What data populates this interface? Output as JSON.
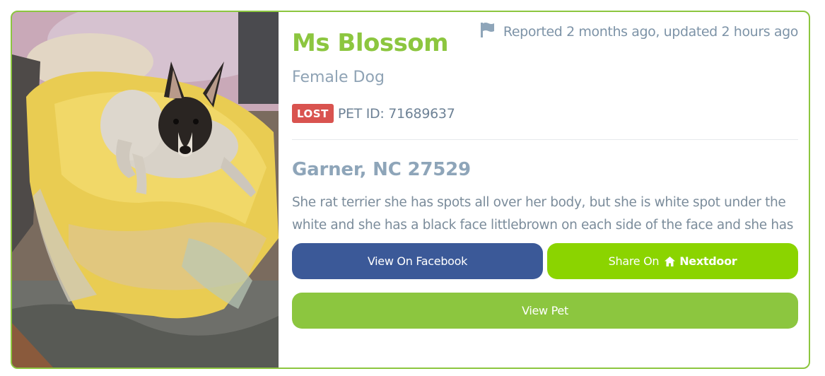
{
  "pet": {
    "name": "Ms Blossom",
    "subtitle": "Female Dog",
    "status_badge": "LOST",
    "pet_id": "PET ID: 71689637",
    "location": "Garner, NC 27529",
    "description": "She rat terrier she has spots all over her body, but she is white spot under the white and she has a black face littlebrown on each side of the face and she has a...",
    "reported": "Reported 2 months ago, updated 2 hours ago",
    "photo_icon": "dog-photo"
  },
  "actions": {
    "facebook_label": "View On Facebook",
    "nextdoor_prefix": "Share On",
    "nextdoor_brand": "Nextdoor",
    "view_pet_label": "View Pet"
  },
  "icons": {
    "flag": "flag-icon",
    "house": "house-icon"
  },
  "colors": {
    "brand_green": "#8cc63f",
    "lost_red": "#d9534f",
    "facebook_blue": "#3b5998",
    "nextdoor_green": "#8bd400",
    "muted_text": "#7b8c9b"
  }
}
